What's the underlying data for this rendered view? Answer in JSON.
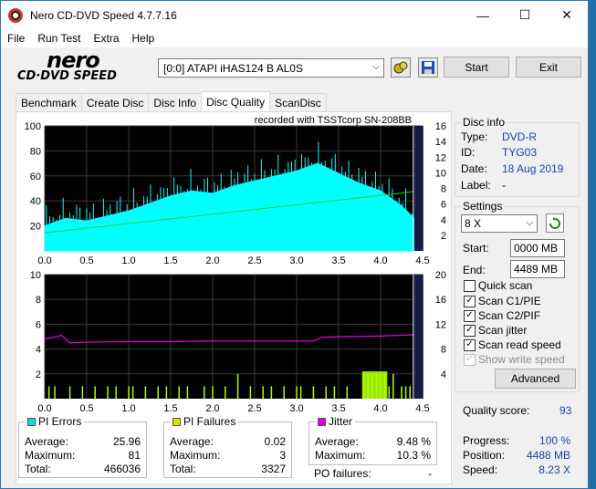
{
  "window": {
    "title": "Nero CD-DVD Speed 4.7.7.16"
  },
  "menu": [
    "File",
    "Run Test",
    "Extra",
    "Help"
  ],
  "logo": {
    "line1": "nero",
    "line2": "CD·DVD SPEED"
  },
  "drive": {
    "selected": "[0:0]   ATAPI iHAS124   B AL0S"
  },
  "buttons": {
    "start": "Start",
    "exit": "Exit",
    "advanced": "Advanced"
  },
  "tabs": [
    "Benchmark",
    "Create Disc",
    "Disc Info",
    "Disc Quality",
    "ScanDisc"
  ],
  "active_tab": "Disc Quality",
  "chart_header": "recorded with TSSTcorp SN-208BB",
  "disc_info": {
    "title": "Disc info",
    "type_label": "Type:",
    "type": "DVD-R",
    "id_label": "ID:",
    "id": "TYG03",
    "date_label": "Date:",
    "date": "18 Aug 2019",
    "label_label": "Label:",
    "label": "-"
  },
  "settings": {
    "title": "Settings",
    "speed": "8 X",
    "start_label": "Start:",
    "start": "0000 MB",
    "end_label": "End:",
    "end": "4489 MB",
    "quick_scan": "Quick scan",
    "scan_c1pie": "Scan C1/PIE",
    "scan_c2pif": "Scan C2/PIF",
    "scan_jitter": "Scan jitter",
    "read_speed": "Scan read speed",
    "write_speed": "Show write speed"
  },
  "quality": {
    "label": "Quality score:",
    "value": "93"
  },
  "progress": {
    "progress_label": "Progress:",
    "progress": "100 %",
    "position_label": "Position:",
    "position": "4488 MB",
    "speed_label": "Speed:",
    "speed": "8.23 X"
  },
  "pi_errors": {
    "title": "PI Errors",
    "color": "#00e0e0",
    "average_label": "Average:",
    "average": "25.96",
    "maximum_label": "Maximum:",
    "maximum": "81",
    "total_label": "Total:",
    "total": "466036"
  },
  "pi_failures": {
    "title": "PI Failures",
    "color": "#e0e000",
    "average_label": "Average:",
    "average": "0.02",
    "maximum_label": "Maximum:",
    "maximum": "3",
    "total_label": "Total:",
    "total": "3327"
  },
  "jitter": {
    "title": "Jitter",
    "color": "#e000e0",
    "average_label": "Average:",
    "average": "9.48 %",
    "maximum_label": "Maximum:",
    "maximum": "10.3 %",
    "po_label": "PO failures:",
    "po": "-"
  },
  "chart_data": [
    {
      "type": "area",
      "series": [
        {
          "name": "PI Errors",
          "color": "#00ffff"
        },
        {
          "name": "Read speed",
          "color": "#22cc22"
        }
      ],
      "x": [
        0.0,
        0.25,
        0.5,
        0.75,
        1.0,
        1.25,
        1.5,
        1.75,
        2.0,
        2.25,
        2.5,
        2.75,
        3.0,
        3.25,
        3.5,
        3.75,
        4.0,
        4.25,
        4.4
      ],
      "pi_values": [
        20,
        26,
        24,
        28,
        32,
        38,
        44,
        48,
        46,
        52,
        56,
        60,
        64,
        70,
        62,
        54,
        48,
        36,
        26
      ],
      "speed_values": [
        2.3,
        2.6,
        2.9,
        3.2,
        3.5,
        3.8,
        4.1,
        4.4,
        4.7,
        5.0,
        5.3,
        5.6,
        5.9,
        6.2,
        6.5,
        6.8,
        7.1,
        7.4,
        7.6
      ],
      "xlim": [
        0,
        4.5
      ],
      "ylim": [
        0,
        100
      ],
      "y2lim": [
        0,
        16
      ],
      "xticks": [
        "0.0",
        "0.5",
        "1.0",
        "1.5",
        "2.0",
        "2.5",
        "3.0",
        "3.5",
        "4.0",
        "4.5"
      ],
      "yticks": [
        "20",
        "40",
        "60",
        "80",
        "100"
      ],
      "y2ticks": [
        "2",
        "4",
        "6",
        "8",
        "10",
        "12",
        "14",
        "16"
      ]
    },
    {
      "type": "bar",
      "series": [
        {
          "name": "PI Failures",
          "color": "#aaff00"
        },
        {
          "name": "Jitter",
          "color": "#dd00dd"
        }
      ],
      "pif_x": [
        0.05,
        0.12,
        0.3,
        0.45,
        0.6,
        0.75,
        0.85,
        1.0,
        1.05,
        1.2,
        1.35,
        1.45,
        1.6,
        1.7,
        1.9,
        2.0,
        2.15,
        2.3,
        2.45,
        2.6,
        2.7,
        2.85,
        3.0,
        3.05,
        3.2,
        3.35,
        3.45,
        3.6,
        3.8,
        3.85,
        3.9,
        3.95,
        4.0,
        4.05,
        4.1,
        4.15,
        4.25,
        4.3,
        4.35
      ],
      "pif_values": [
        1,
        1,
        1,
        1,
        1,
        1,
        1,
        1,
        1,
        1,
        1,
        1,
        1,
        1,
        1,
        1,
        1,
        2,
        1,
        1,
        1,
        1,
        1,
        1,
        1,
        1,
        1,
        1,
        2,
        2,
        2,
        2,
        2,
        2,
        1,
        2,
        1,
        1,
        1
      ],
      "jitter_x": [
        0.0,
        0.2,
        0.3,
        0.5,
        1.0,
        1.5,
        2.0,
        2.5,
        3.0,
        3.2,
        3.3,
        3.5,
        4.0,
        4.4
      ],
      "jitter_values": [
        9.6,
        10.2,
        9.0,
        9.1,
        9.2,
        9.2,
        9.3,
        9.3,
        9.3,
        9.3,
        9.9,
        10.0,
        10.1,
        10.3
      ],
      "xlim": [
        0,
        4.5
      ],
      "ylim": [
        0,
        10
      ],
      "y2lim": [
        0,
        20
      ],
      "xticks": [
        "0.0",
        "0.5",
        "1.0",
        "1.5",
        "2.0",
        "2.5",
        "3.0",
        "3.5",
        "4.0",
        "4.5"
      ],
      "yticks": [
        "2",
        "4",
        "6",
        "8",
        "10"
      ],
      "y2ticks": [
        "4",
        "8",
        "12",
        "16",
        "20"
      ]
    }
  ]
}
